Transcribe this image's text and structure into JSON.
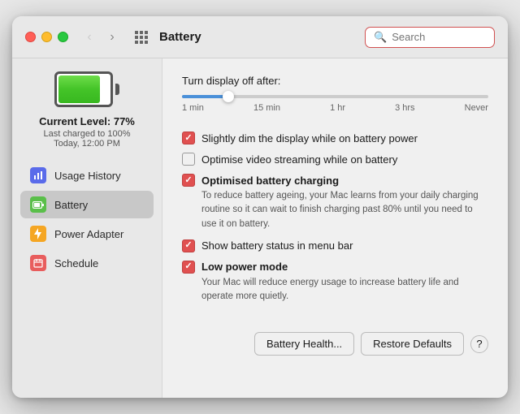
{
  "window": {
    "title": "Battery"
  },
  "titlebar": {
    "back_disabled": true,
    "forward_disabled": false,
    "search_placeholder": "Search"
  },
  "battery_display": {
    "level_label": "Current Level: 77%",
    "charged_label": "Last charged to 100%",
    "time_label": "Today, 12:00 PM",
    "fill_percent": 77
  },
  "sidebar": {
    "items": [
      {
        "id": "usage-history",
        "label": "Usage History",
        "icon": "chart-icon",
        "active": false
      },
      {
        "id": "battery",
        "label": "Battery",
        "icon": "battery-icon",
        "active": true
      },
      {
        "id": "power-adapter",
        "label": "Power Adapter",
        "icon": "bolt-icon",
        "active": false
      },
      {
        "id": "schedule",
        "label": "Schedule",
        "icon": "calendar-icon",
        "active": false
      }
    ]
  },
  "panel": {
    "slider_label": "Turn display off after:",
    "slider_marks": [
      "1 min",
      "15 min",
      "1 hr",
      "3 hrs",
      "Never"
    ],
    "options": [
      {
        "id": "dim-display",
        "label": "Slightly dim the display while on battery power",
        "checked": true,
        "bold": false,
        "desc": ""
      },
      {
        "id": "video-streaming",
        "label": "Optimise video streaming while on battery",
        "checked": false,
        "bold": false,
        "desc": ""
      },
      {
        "id": "optimised-charging",
        "label": "Optimised battery charging",
        "checked": true,
        "bold": true,
        "desc": "To reduce battery ageing, your Mac learns from your daily charging routine so it can wait to finish charging past 80% until you need to use it on battery."
      },
      {
        "id": "menu-bar",
        "label": "Show battery status in menu bar",
        "checked": true,
        "bold": false,
        "desc": ""
      },
      {
        "id": "low-power",
        "label": "Low power mode",
        "checked": true,
        "bold": true,
        "desc": "Your Mac will reduce energy usage to increase battery life and operate more quietly."
      }
    ],
    "buttons": {
      "health": "Battery Health...",
      "restore": "Restore Defaults",
      "help": "?"
    }
  }
}
